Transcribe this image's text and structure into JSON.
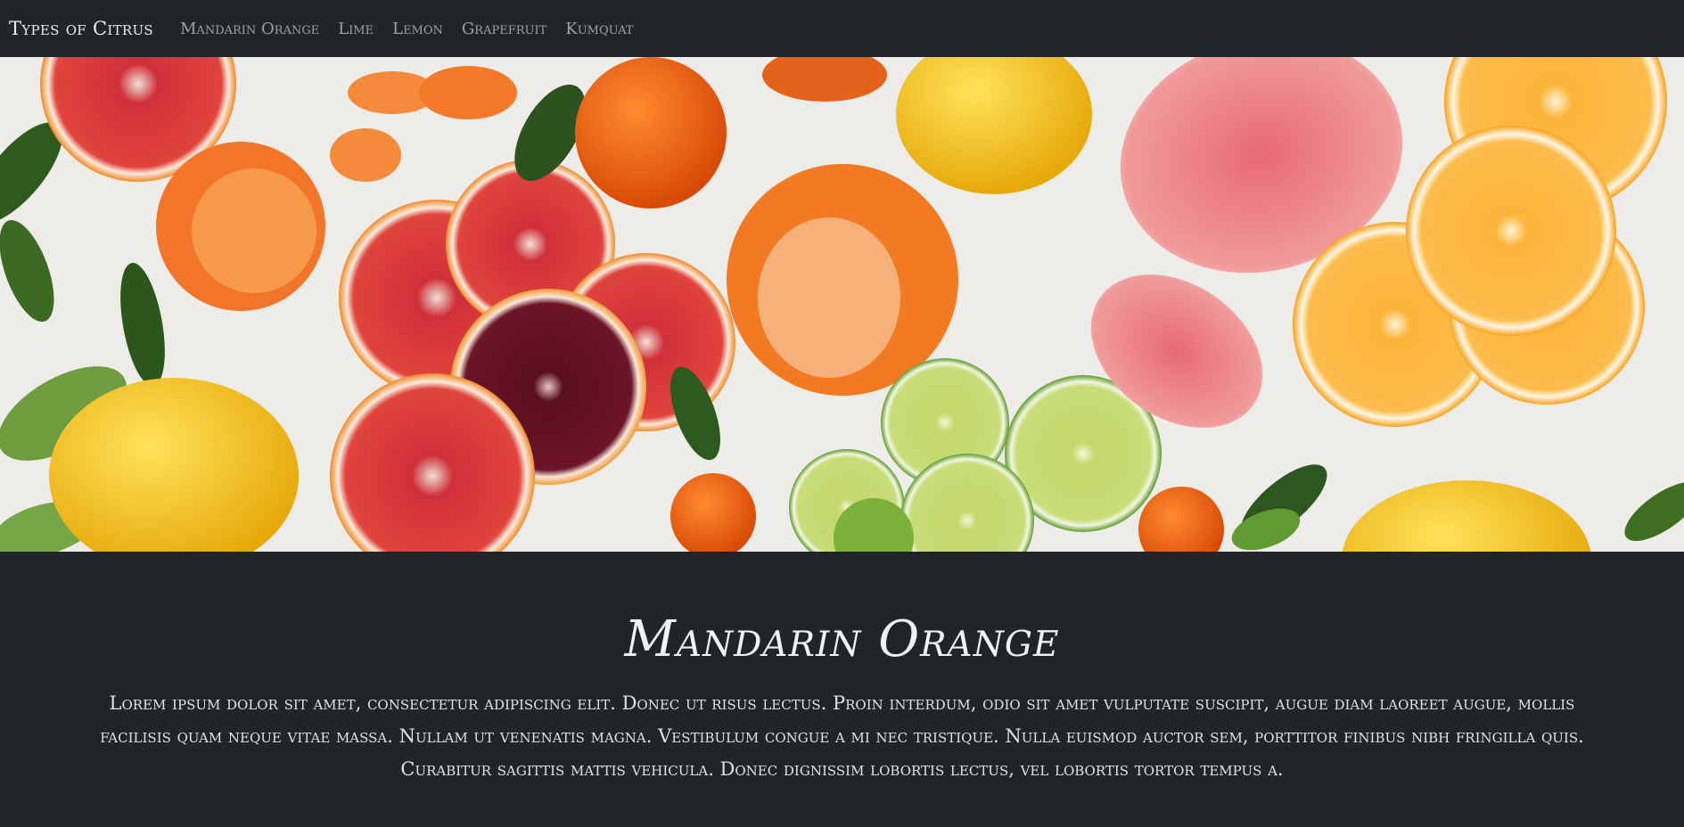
{
  "navbar": {
    "brand": "Types of Citrus",
    "links": [
      "Mandarin Orange",
      "Lime",
      "Lemon",
      "Grapefruit",
      "Kumquat"
    ]
  },
  "hero": {
    "image_subject": "citrus-fruits-flatlay"
  },
  "main": {
    "title": "Mandarin Orange",
    "body": "Lorem ipsum dolor sit amet, consectetur adipiscing elit. Donec ut risus lectus. Proin interdum, odio sit amet vulputate suscipit, augue diam laoreet augue, mollis facilisis quam neque vitae massa. Nullam ut venenatis magna. Vestibulum congue a mi nec tristique. Nulla euismod auctor sem, porttitor finibus nibh fringilla quis. Curabitur sagittis mattis vehicula. Donec dignissim lobortis lectus, vel lobortis tortor tempus a."
  },
  "colors": {
    "background": "#212529",
    "text": "#f1f3f5",
    "link": "#9aa0a6"
  }
}
